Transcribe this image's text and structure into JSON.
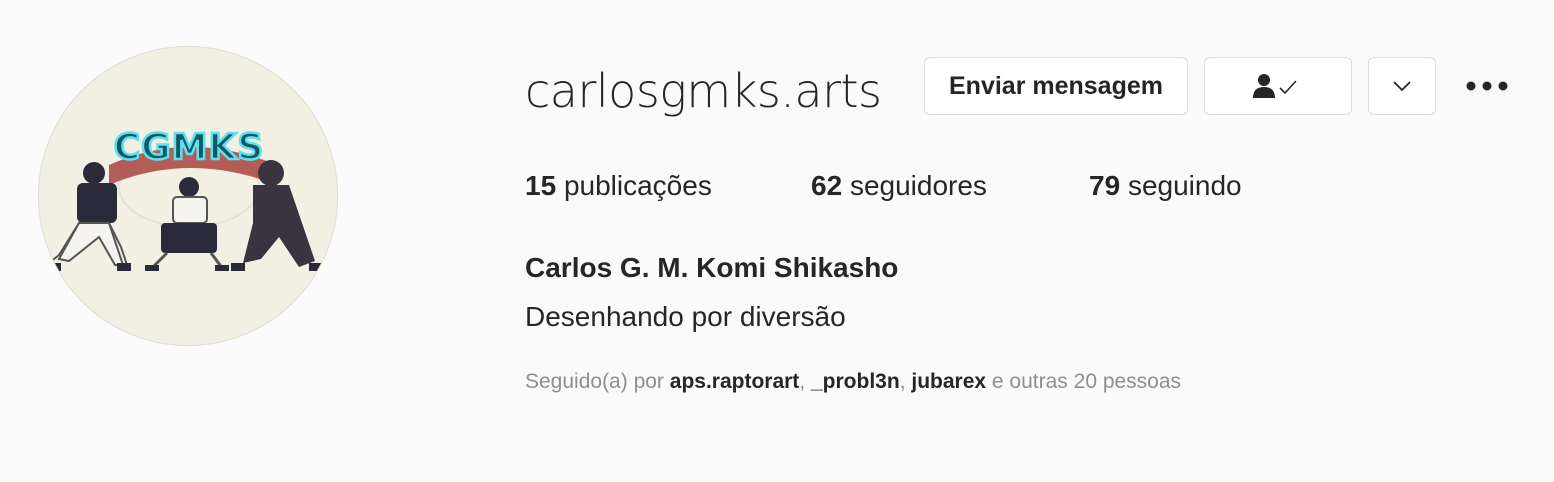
{
  "profile": {
    "username": "carlosgmks.arts",
    "full_name": "Carlos G. M. Komi Shikasho",
    "bio": "Desenhando por diversão",
    "avatar_text": "CGMKS",
    "avatar_icon": "avatar-image"
  },
  "actions": {
    "message_label": "Enviar mensagem",
    "following_icon": "person-check-icon",
    "suggest_icon": "chevron-down-icon",
    "more_icon": "more-horizontal-icon"
  },
  "stats": {
    "posts": {
      "count": "15",
      "label": "publicações"
    },
    "followers": {
      "count": "62",
      "label": "seguidores"
    },
    "following": {
      "count": "79",
      "label": "seguindo"
    }
  },
  "followed_by": {
    "prefix": "Seguido(a) por",
    "accounts": [
      "aps.raptorart",
      "_probl3n",
      "jubarex"
    ],
    "separator": ",",
    "suffix": "e outras 20 pessoas"
  },
  "colors": {
    "background": "#fafafa",
    "text_primary": "#262626",
    "text_secondary": "#8e8e8e",
    "border": "#dbdbdb",
    "logo_glow": "#34c4d4"
  }
}
